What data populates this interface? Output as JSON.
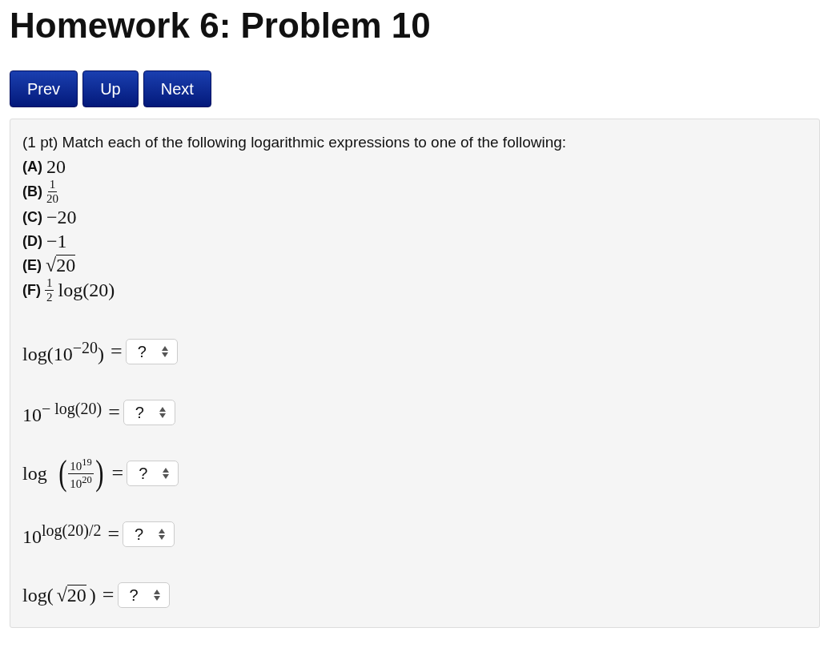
{
  "title": "Homework 6: Problem 10",
  "nav_buttons": [
    "Prev",
    "Up",
    "Next"
  ],
  "problem": {
    "intro": "(1 pt) Match each of the following logarithmic expressions to one of the following:",
    "choices": [
      {
        "label": "(A)",
        "parts": [
          {
            "kind": "text",
            "text": "20"
          }
        ]
      },
      {
        "label": "(B)",
        "parts": [
          {
            "kind": "frac",
            "num": "1",
            "den": "20"
          }
        ]
      },
      {
        "label": "(C)",
        "parts": [
          {
            "kind": "text",
            "text": "−20"
          }
        ]
      },
      {
        "label": "(D)",
        "parts": [
          {
            "kind": "text",
            "text": "−1"
          }
        ]
      },
      {
        "label": "(E)",
        "parts": [
          {
            "kind": "sqrt",
            "sign": "√",
            "text": "20"
          }
        ]
      },
      {
        "label": "(F)",
        "parts": [
          {
            "kind": "frac",
            "num": "1",
            "den": "2"
          },
          {
            "kind": "text",
            "text": "log(20)"
          }
        ]
      }
    ],
    "questions": [
      {
        "parts": [
          {
            "kind": "text",
            "text": "log(10$^{−20}$)"
          }
        ],
        "equals": "=",
        "answer": "?"
      },
      {
        "parts": [
          {
            "kind": "text",
            "text": "10$^{− log(20)}$"
          }
        ],
        "equals": "=",
        "answer": "?"
      },
      {
        "parts": [
          {
            "kind": "text",
            "text": "log"
          },
          {
            "kind": "pfrac",
            "open": "(",
            "num": "10$^{19}$",
            "den": "10$^{20}$",
            "close": ")"
          }
        ],
        "equals": "=",
        "answer": "?"
      },
      {
        "parts": [
          {
            "kind": "text",
            "text": "10$^{log(20)/2}$"
          }
        ],
        "equals": "=",
        "answer": "?"
      },
      {
        "parts": [
          {
            "kind": "text",
            "text": "log("
          },
          {
            "kind": "sqrt",
            "sign": "√",
            "text": "20"
          },
          {
            "kind": "text",
            "text": ")"
          }
        ],
        "equals": "=",
        "answer": "?"
      }
    ]
  }
}
